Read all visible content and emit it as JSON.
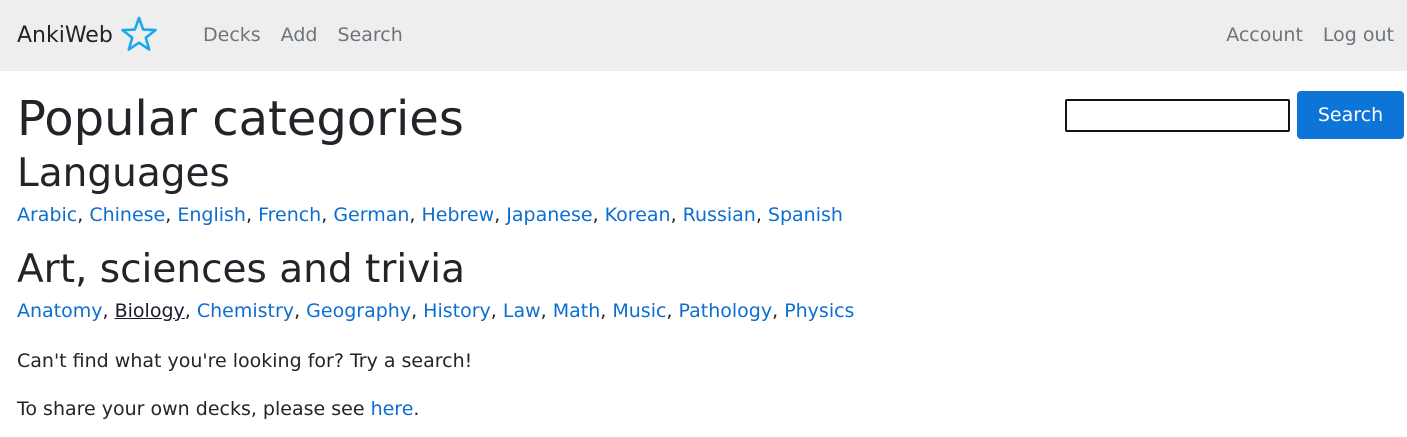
{
  "navbar": {
    "brand": "AnkiWeb",
    "brand_icon": "star-outline-icon",
    "left_links": [
      {
        "name": "nav-decks",
        "label": "Decks"
      },
      {
        "name": "nav-add",
        "label": "Add"
      },
      {
        "name": "nav-search",
        "label": "Search"
      }
    ],
    "right_links": [
      {
        "name": "nav-account",
        "label": "Account"
      },
      {
        "name": "nav-logout",
        "label": "Log out"
      }
    ],
    "colors": {
      "background": "#eeeeee",
      "star": "#1ea7f0"
    }
  },
  "search": {
    "value": "",
    "button_label": "Search",
    "button_color": "#0d74d8"
  },
  "main": {
    "title": "Popular categories",
    "sections": [
      {
        "title": "Languages",
        "items": [
          "Arabic",
          "Chinese",
          "English",
          "French",
          "German",
          "Hebrew",
          "Japanese",
          "Korean",
          "Russian",
          "Spanish"
        ]
      },
      {
        "title": "Art, sciences and trivia",
        "items": [
          "Anatomy",
          "Biology",
          "Chemistry",
          "Geography",
          "History",
          "Law",
          "Math",
          "Music",
          "Pathology",
          "Physics"
        ],
        "active_item": "Biology"
      }
    ],
    "cant_find": "Can't find what you're looking for? Try a search!",
    "share_prefix": "To share your own decks, please see ",
    "share_link": "here",
    "share_suffix": "."
  }
}
